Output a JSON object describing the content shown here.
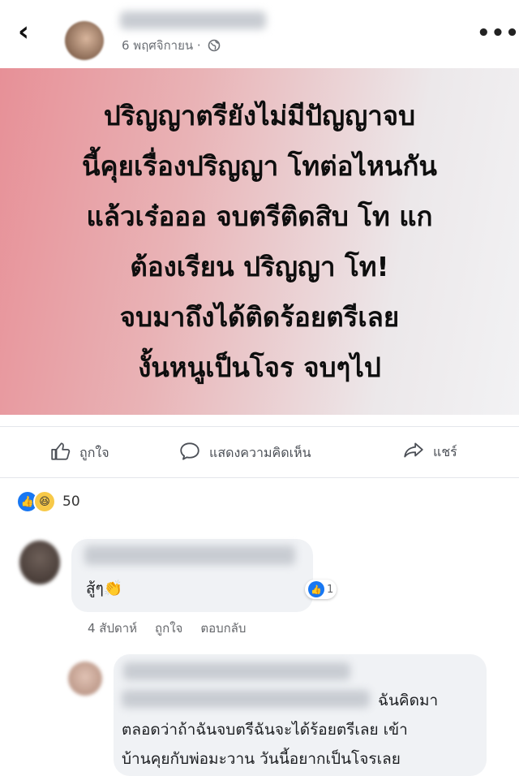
{
  "post": {
    "date": "6 พฤศจิกายน ·",
    "globe_icon": "globe-icon",
    "banner_lines": [
      "ปริญญาตรียังไม่มีปัญญาจบ",
      "นี้คุยเรื่องปริญญา โทต่อไหนกัน",
      "แล้วเร๋อออ จบตรีติดสิบ โท แก",
      "ต้องเรียน ปริญญา โท!",
      "จบมาถึงได้ติดร้อยตรีเลย",
      "งั้นหนูเป็นโจร จบๆไป"
    ],
    "banner_colors": {
      "left": "#e79097",
      "right": "#f2f2f4"
    }
  },
  "actions": {
    "like": "ถูกใจ",
    "comment": "แสดงความคิดเห็น",
    "share": "แชร์"
  },
  "reactions": {
    "count": "50",
    "icons": [
      "like-icon",
      "haha-icon"
    ]
  },
  "comments": [
    {
      "text": "สู้ๆ👏",
      "reaction_count": "1",
      "time": "4 สัปดาห์",
      "like": "ถูกใจ",
      "reply": "ตอบกลับ"
    },
    {
      "line1": "ฉันคิดมา",
      "line2": "ตลอดว่าถ้าฉันจบตรีฉันจะได้ร้อยตรีเลย เข้า",
      "line3": "บ้านคุยกับพ่อมะวาน วันนี้อยากเป็นโจรเลย"
    }
  ]
}
